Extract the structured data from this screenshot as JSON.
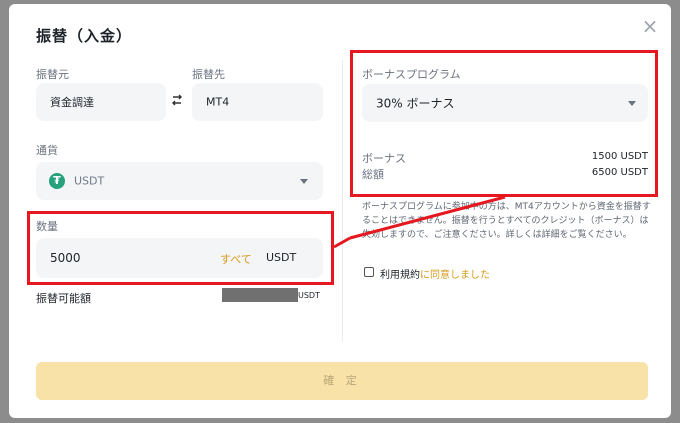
{
  "title": "振替（入金）",
  "from": {
    "label": "振替元",
    "value": "資金調達"
  },
  "to": {
    "label": "振替先",
    "value": "MT4"
  },
  "currency": {
    "label": "通貨",
    "value": "USDT",
    "icon": "tether-icon",
    "icon_glyph": "₮"
  },
  "amount": {
    "label": "数量",
    "value": "5000",
    "all_label": "すべて",
    "unit": "USDT"
  },
  "available": {
    "label": "振替可能額",
    "unit": "USDT"
  },
  "bonus": {
    "section_label": "ボーナスプログラム",
    "selected": "30% ボーナス",
    "rows": [
      {
        "label": "ボーナス",
        "value": "1500 USDT"
      },
      {
        "label": "総額",
        "value": "6500 USDT"
      }
    ],
    "note": "ボーナスプログラムに参加中の方は、MT4アカウントから資金を振替することはできません。振替を行うとすべてのクレジット（ボーナス）は失効しますので、ご注意ください。詳しくは詳細をご覧ください。"
  },
  "terms": {
    "prefix": "利用規約",
    "link": "に同意しました"
  },
  "confirm_label": "確 定",
  "close_glyph": "×",
  "colors": {
    "accent": "#f0b90b",
    "highlight": "#e5171f",
    "tether": "#26a17b"
  }
}
